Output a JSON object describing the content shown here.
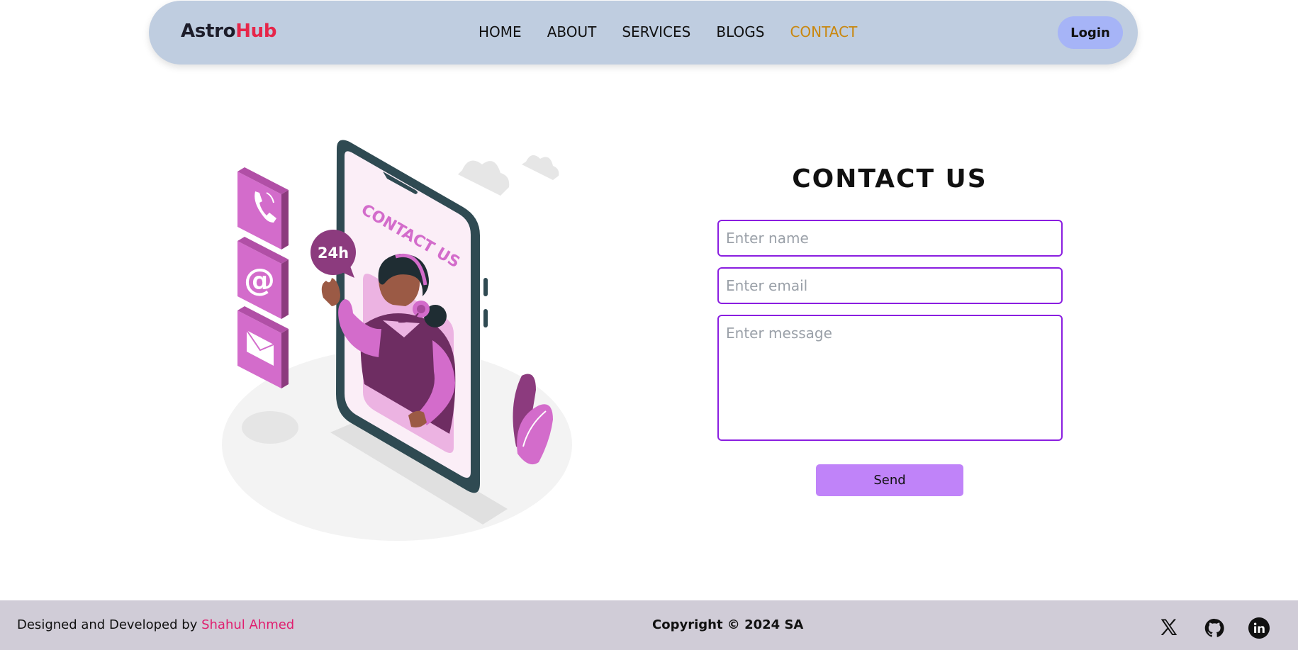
{
  "brand": {
    "part1": "Astro",
    "part2": "Hub"
  },
  "nav": {
    "items": [
      {
        "label": "HOME"
      },
      {
        "label": "ABOUT"
      },
      {
        "label": "SERVICES"
      },
      {
        "label": "BLOGS"
      },
      {
        "label": "CONTACT",
        "active": true
      }
    ],
    "login_label": "Login"
  },
  "illustration": {
    "phone_text": "CONTACT US",
    "badge_text": "24h",
    "icons": [
      "phone-icon",
      "at-sign-icon",
      "envelope-icon"
    ]
  },
  "contact": {
    "title": "CONTACT US",
    "name_placeholder": "Enter name",
    "email_placeholder": "Enter email",
    "message_placeholder": "Enter message",
    "send_label": "Send"
  },
  "footer": {
    "credit_prefix": "Designed and Developed by ",
    "author": "Shahul Ahmed",
    "copyright": "Copyright © 2024 SA",
    "social": [
      "x-icon",
      "github-icon",
      "linkedin-icon"
    ]
  },
  "colors": {
    "nav_bg": "#bfcde0",
    "active_link": "#c9870e",
    "brand_accent": "#e6264a",
    "login_bg": "#a6b4f7",
    "field_border": "#8a1ee0",
    "send_bg": "#c083f9",
    "footer_bg": "#d0ccd7",
    "author_link": "#e01e6f"
  }
}
